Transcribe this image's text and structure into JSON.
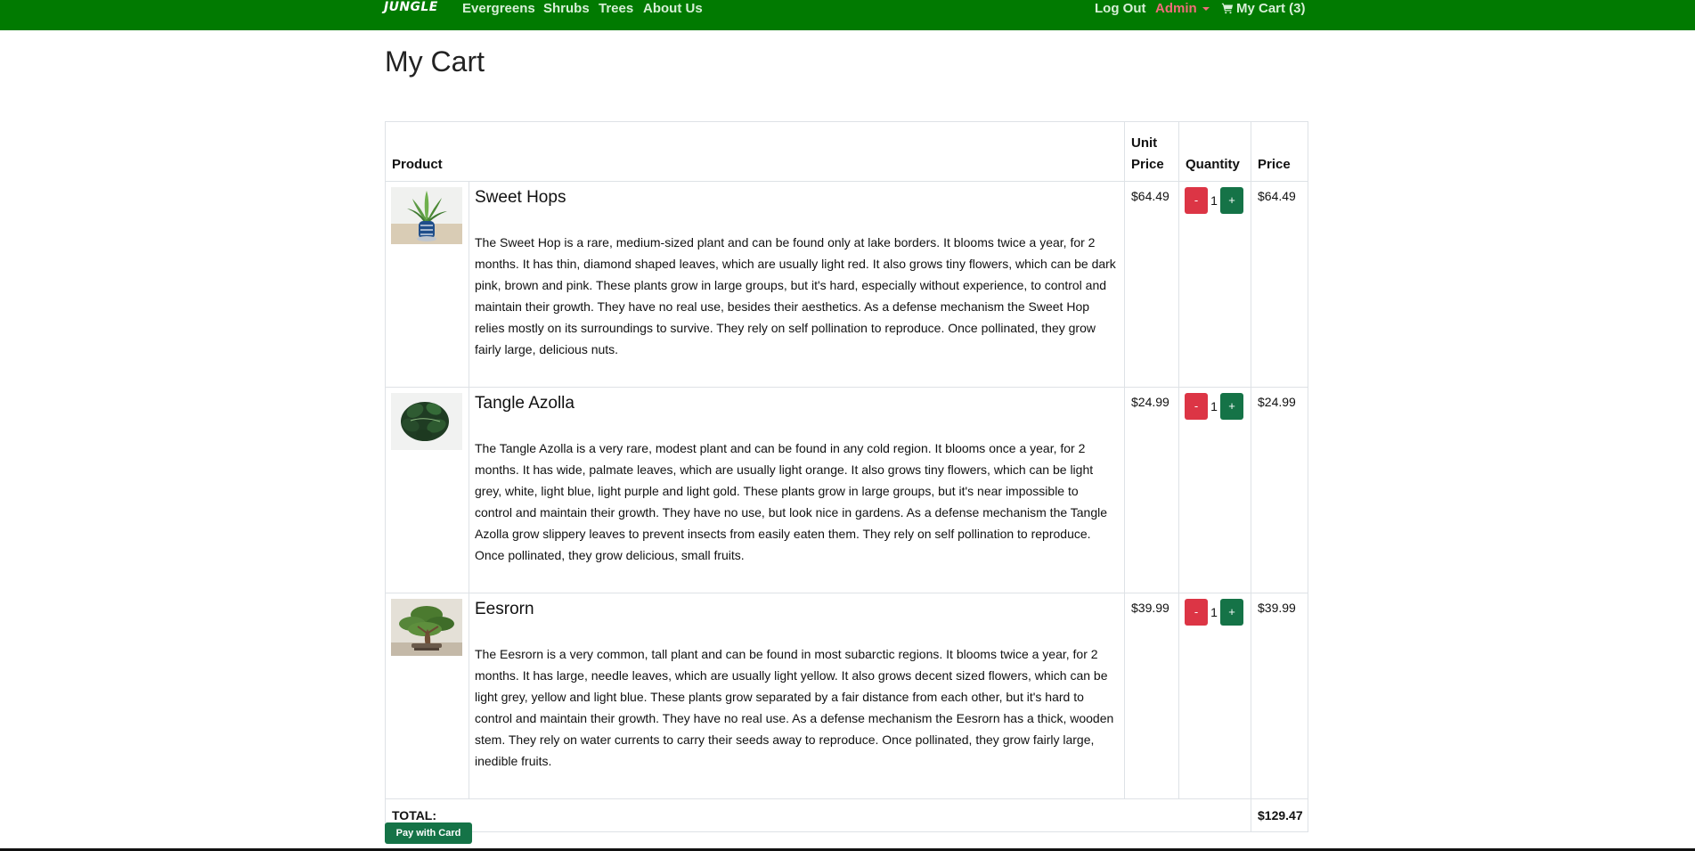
{
  "nav": {
    "brand": "JUNGLE",
    "items": [
      {
        "label": "Evergreens"
      },
      {
        "label": "Shrubs"
      },
      {
        "label": "Trees"
      },
      {
        "label": "About Us"
      }
    ],
    "logout": "Log Out",
    "admin": "Admin",
    "cart": "My Cart (3)"
  },
  "page": {
    "title": "My Cart"
  },
  "table": {
    "headers": {
      "product": "Product",
      "unit_price_line1": "Unit",
      "unit_price_line2": "Price",
      "quantity": "Quantity",
      "price": "Price"
    },
    "items": [
      {
        "name": "Sweet Hops",
        "description": "The Sweet Hop is a rare, medium-sized plant and can be found only at lake borders. It blooms twice a year, for 2 months. It has thin, diamond shaped leaves, which are usually light red. It also grows tiny flowers, which can be dark pink, brown and pink. These plants grow in large groups, but it's hard, especially without experience, to control and maintain their growth. They have no real use, besides their aesthetics. As a defense mechanism the Sweet Hop relies mostly on its surroundings to survive. They rely on self pollination to reproduce. Once pollinated, they grow fairly large, delicious nuts.",
        "unit_price": "$64.49",
        "quantity": "1",
        "price": "$64.49",
        "minus": "-",
        "plus": "+",
        "image_icon": "potted-plant-image"
      },
      {
        "name": "Tangle Azolla",
        "description": "The Tangle Azolla is a very rare, modest plant and can be found in any cold region. It blooms once a year, for 2 months. It has wide, palmate leaves, which are usually light orange. It also grows tiny flowers, which can be light grey, white, light blue, light purple and light gold. These plants grow in large groups, but it's near impossible to control and maintain their growth. They have no use, but look nice in gardens. As a defense mechanism the Tangle Azolla grow slippery leaves to prevent insects from easily eaten them. They rely on self pollination to reproduce. Once pollinated, they grow delicious, small fruits.",
        "unit_price": "$24.99",
        "quantity": "1",
        "price": "$24.99",
        "minus": "-",
        "plus": "+",
        "image_icon": "leafy-plant-image"
      },
      {
        "name": "Eesrorn",
        "description": "The Eesrorn is a very common, tall plant and can be found in most subarctic regions. It blooms twice a year, for 2 months. It has large, needle leaves, which are usually light yellow. It also grows decent sized flowers, which can be light grey, yellow and light blue. These plants grow separated by a fair distance from each other, but it's hard to control and maintain their growth. They have no real use. As a defense mechanism the Eesrorn has a thick, wooden stem. They rely on water currents to carry their seeds away to reproduce. Once pollinated, they grow fairly large, inedible fruits.",
        "unit_price": "$39.99",
        "quantity": "1",
        "price": "$39.99",
        "minus": "-",
        "plus": "+",
        "image_icon": "bonsai-tree-image"
      }
    ],
    "total_label": "TOTAL:",
    "total_value": "$129.47"
  },
  "actions": {
    "pay_label": "Pay with Card"
  },
  "icons": {
    "cart": "shopping-cart-icon",
    "admin_dropdown": "chevron-down-icon"
  },
  "colors": {
    "nav_background": "#017a01",
    "admin": "#f06d7a",
    "danger": "#dc3545",
    "success": "#157347"
  }
}
